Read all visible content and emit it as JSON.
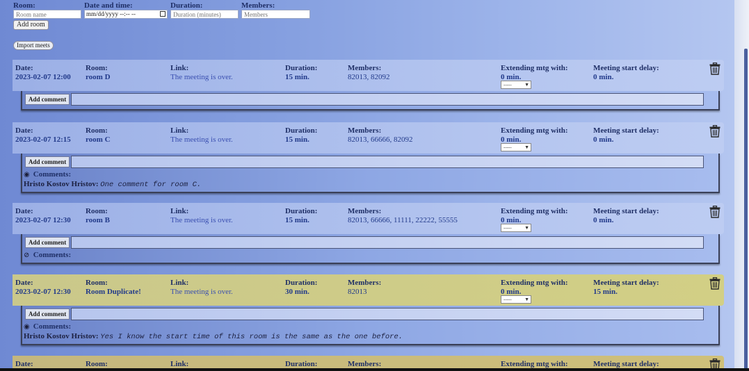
{
  "form": {
    "room_label": "Room:",
    "room_placeholder": "Room name",
    "date_label": "Date and time:",
    "date_value": "mm/dd/yyyy --:-- --",
    "duration_label": "Duration:",
    "duration_placeholder": "Duration (minutes)",
    "members_label": "Members:",
    "members_placeholder": "Members",
    "add_room_button": "Add room",
    "import_button": "Import meets"
  },
  "labels": {
    "date": "Date:",
    "room": "Room:",
    "link": "Link:",
    "duration": "Duration:",
    "members": "Members:",
    "extending": "Extending mtg with:",
    "start_delay": "Meeting start delay:",
    "add_comment": "Add comment",
    "comments": "Comments:",
    "select_placeholder": "-----"
  },
  "meetings": [
    {
      "date": "2023-02-07 12:00",
      "room": "room D",
      "link": "The meeting is over.",
      "duration": "15 min.",
      "members": "82013, 82092",
      "extending": "0 min.",
      "delay": "0 min.",
      "color": "#aabcec",
      "comments_toggle": false,
      "comments_visible": true,
      "comments": []
    },
    {
      "date": "2023-02-07 12:15",
      "room": "room C",
      "link": "The meeting is over.",
      "duration": "15 min.",
      "members": "82013, 66666, 82092",
      "extending": "0 min.",
      "delay": "0 min.",
      "color": "#aabcec",
      "comments_toggle": true,
      "comments_visible": true,
      "comments": [
        {
          "author": "Hristo Kostov Hristov:",
          "text": "One comment for room C."
        }
      ]
    },
    {
      "date": "2023-02-07 12:30",
      "room": "room B",
      "link": "The meeting is over.",
      "duration": "15 min.",
      "members": "82013, 66666, 11111, 22222, 55555",
      "extending": "0 min.",
      "delay": "0 min.",
      "color": "#aabcec",
      "comments_toggle": true,
      "comments_visible": false,
      "comments": []
    },
    {
      "date": "2023-02-07 12:30",
      "room": "Room Duplicate!",
      "link": "The meeting is over.",
      "duration": "30 min.",
      "members": "82013",
      "extending": "0 min.",
      "delay": "15 min.",
      "color": "#cac88b",
      "comments_toggle": true,
      "comments_visible": true,
      "comments": [
        {
          "author": "Hristo Kostov Hristov:",
          "text": "Yes I know the start time of this room is the same as the one before."
        }
      ]
    }
  ]
}
